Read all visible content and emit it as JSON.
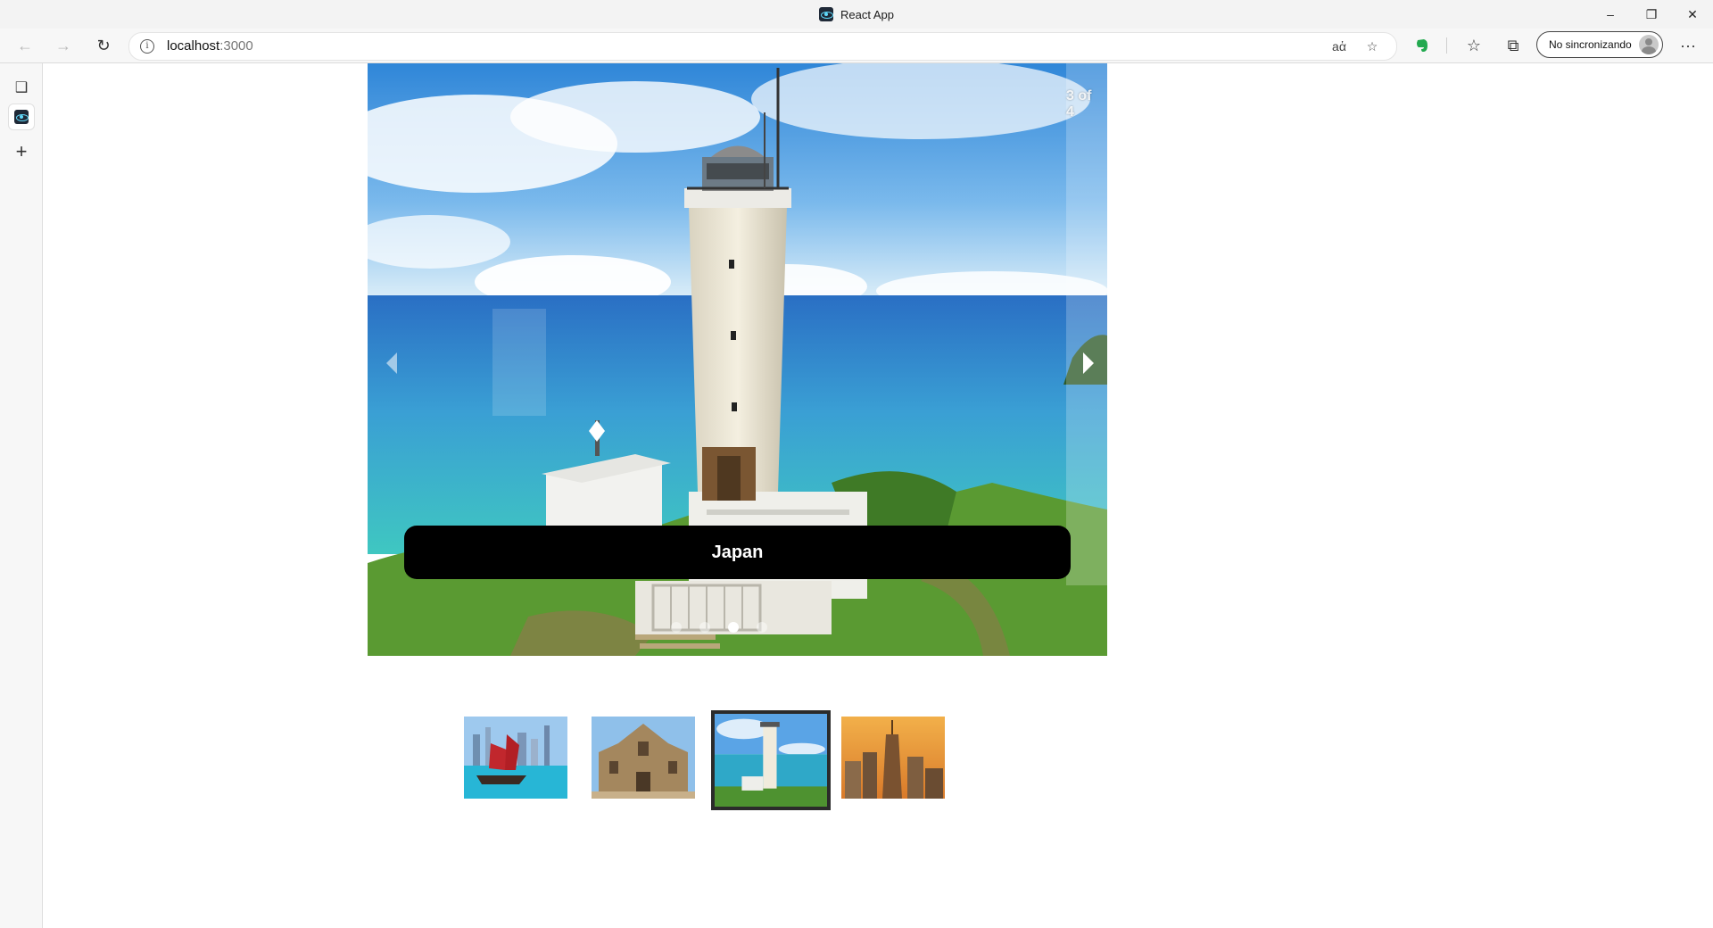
{
  "window": {
    "title": "React App",
    "controls": [
      "minimize",
      "restore",
      "close"
    ]
  },
  "toolbar": {
    "back_icon": "arrow-left-icon",
    "forward_icon": "arrow-right-icon",
    "refresh_icon": "refresh-icon",
    "url_host": "localhost",
    "url_port": ":3000",
    "sync_label": "No sincronizando",
    "more_label": "···"
  },
  "siderail": {
    "items": [
      "tab-actions-icon",
      "react-app-tab-icon",
      "new-tab-icon"
    ]
  },
  "carousel": {
    "counter": "3 of 4",
    "caption": "Japan",
    "slide_count": 4,
    "active_index": 2
  },
  "thumbnails": [
    {
      "subject": "harbor-junk-boat",
      "selected": false
    },
    {
      "subject": "baroque-church-ruins",
      "selected": false
    },
    {
      "subject": "lighthouse",
      "selected": true
    },
    {
      "subject": "city-skyline-sunset",
      "selected": false
    }
  ],
  "colors": {
    "caption_bg": "#000000",
    "thumb_border": "#2b2b2b",
    "sky": "#2f8fe0",
    "sea": "#2bb3bd",
    "grass": "#5a9a32"
  }
}
